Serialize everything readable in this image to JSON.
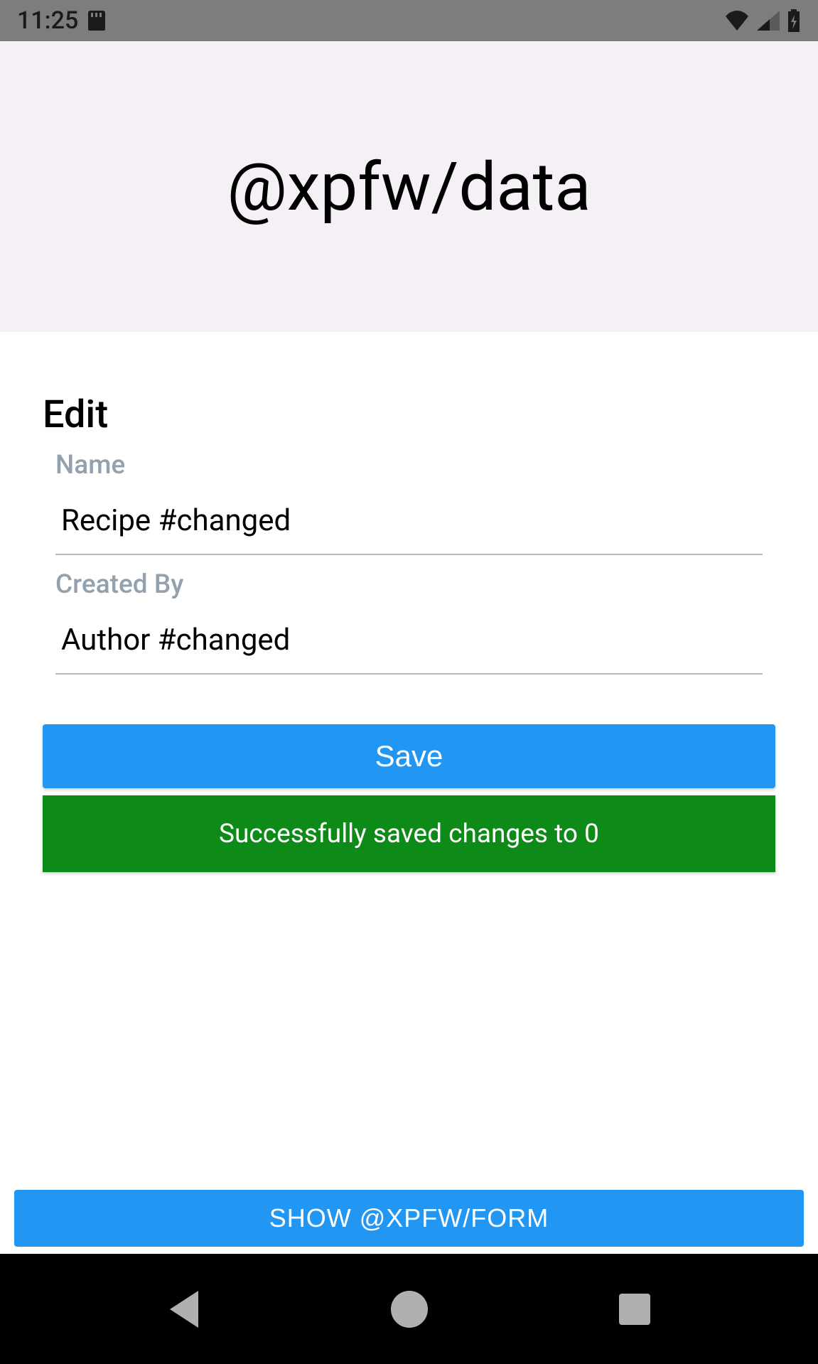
{
  "statusBar": {
    "time": "11:25"
  },
  "header": {
    "title": "@xpfw/data"
  },
  "form": {
    "sectionTitle": "Edit",
    "fields": {
      "name": {
        "label": "Name",
        "value": "Recipe #changed"
      },
      "createdBy": {
        "label": "Created By",
        "value": "Author #changed"
      }
    },
    "saveLabel": "Save",
    "successMessage": "Successfully saved changes to 0"
  },
  "bottom": {
    "showButtonLabel": "SHOW @XPFW/FORM"
  }
}
